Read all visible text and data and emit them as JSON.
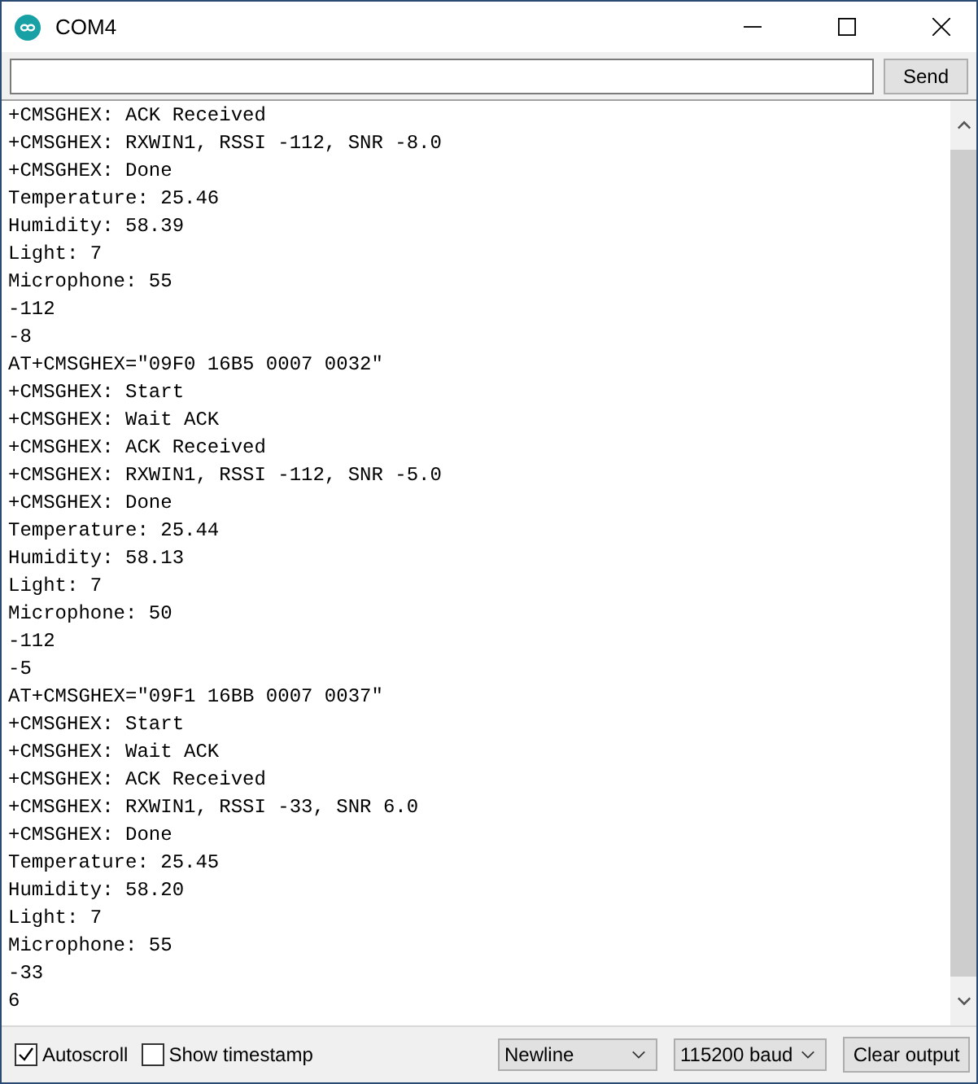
{
  "window": {
    "title": "COM4"
  },
  "send_button": "Send",
  "output_lines": [
    "+CMSGHEX: ACK Received",
    "+CMSGHEX: RXWIN1, RSSI -112, SNR -8.0",
    "+CMSGHEX: Done",
    "Temperature: 25.46",
    "Humidity: 58.39",
    "Light: 7",
    "Microphone: 55",
    "-112",
    "-8",
    "AT+CMSGHEX=\"09F0 16B5 0007 0032\"",
    "+CMSGHEX: Start",
    "+CMSGHEX: Wait ACK",
    "+CMSGHEX: ACK Received",
    "+CMSGHEX: RXWIN1, RSSI -112, SNR -5.0",
    "+CMSGHEX: Done",
    "Temperature: 25.44",
    "Humidity: 58.13",
    "Light: 7",
    "Microphone: 50",
    "-112",
    "-5",
    "AT+CMSGHEX=\"09F1 16BB 0007 0037\"",
    "+CMSGHEX: Start",
    "+CMSGHEX: Wait ACK",
    "+CMSGHEX: ACK Received",
    "+CMSGHEX: RXWIN1, RSSI -33, SNR 6.0",
    "+CMSGHEX: Done",
    "Temperature: 25.45",
    "Humidity: 58.20",
    "Light: 7",
    "Microphone: 55",
    "-33",
    "6"
  ],
  "checkboxes": [
    {
      "label": "Autoscroll",
      "checked": true
    },
    {
      "label": "Show timestamp",
      "checked": false
    }
  ],
  "line_ending": "Newline",
  "baud": "115200 baud",
  "clear_button": "Clear output"
}
